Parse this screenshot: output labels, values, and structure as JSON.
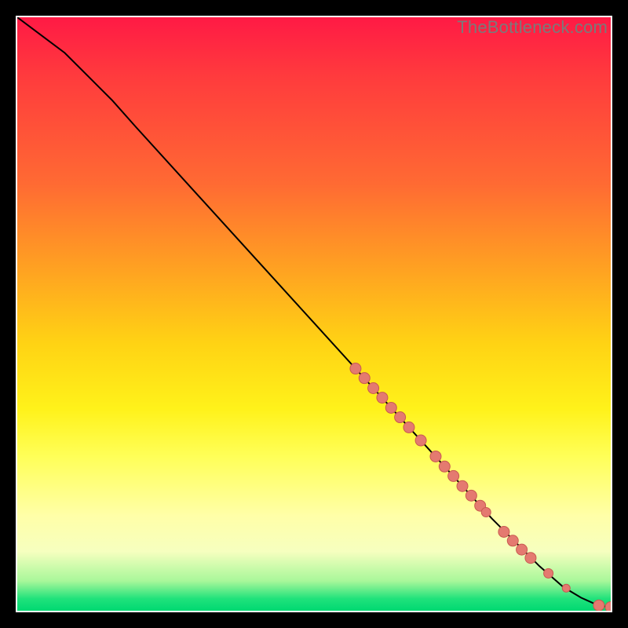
{
  "watermark": "TheBottleneck.com",
  "colors": {
    "point_fill": "#e47a70",
    "point_stroke": "#c95a50",
    "curve": "#000000"
  },
  "chart_data": {
    "type": "line",
    "title": "",
    "xlabel": "",
    "ylabel": "",
    "xlim": [
      0,
      100
    ],
    "ylim": [
      0,
      100
    ],
    "grid": false,
    "curve": {
      "x": [
        0,
        4,
        8,
        12,
        16,
        20,
        30,
        40,
        50,
        60,
        70,
        80,
        88,
        92,
        95,
        97,
        98.5,
        100
      ],
      "y": [
        100,
        97,
        94,
        90,
        86,
        81.5,
        70.5,
        59.5,
        48.5,
        37.5,
        26.5,
        15.5,
        7.5,
        4.0,
        2.2,
        1.3,
        0.8,
        0.6
      ]
    },
    "points": [
      {
        "x": 57.0,
        "y": 40.8,
        "r": 7
      },
      {
        "x": 58.5,
        "y": 39.2,
        "r": 7
      },
      {
        "x": 60.0,
        "y": 37.5,
        "r": 7
      },
      {
        "x": 61.5,
        "y": 35.9,
        "r": 7
      },
      {
        "x": 63.0,
        "y": 34.2,
        "r": 7
      },
      {
        "x": 64.5,
        "y": 32.6,
        "r": 7
      },
      {
        "x": 66.0,
        "y": 30.9,
        "r": 7
      },
      {
        "x": 68.0,
        "y": 28.7,
        "r": 7
      },
      {
        "x": 70.5,
        "y": 26.0,
        "r": 7
      },
      {
        "x": 72.0,
        "y": 24.3,
        "r": 7
      },
      {
        "x": 73.5,
        "y": 22.7,
        "r": 7
      },
      {
        "x": 75.0,
        "y": 21.0,
        "r": 7
      },
      {
        "x": 76.5,
        "y": 19.4,
        "r": 7
      },
      {
        "x": 78.0,
        "y": 17.7,
        "r": 7
      },
      {
        "x": 79.0,
        "y": 16.6,
        "r": 6
      },
      {
        "x": 82.0,
        "y": 13.3,
        "r": 7
      },
      {
        "x": 83.5,
        "y": 11.8,
        "r": 7
      },
      {
        "x": 85.0,
        "y": 10.3,
        "r": 7
      },
      {
        "x": 86.5,
        "y": 8.9,
        "r": 7
      },
      {
        "x": 89.5,
        "y": 6.3,
        "r": 6
      },
      {
        "x": 92.5,
        "y": 3.8,
        "r": 5
      },
      {
        "x": 98.0,
        "y": 0.9,
        "r": 7
      },
      {
        "x": 100.0,
        "y": 0.6,
        "r": 7
      }
    ]
  }
}
